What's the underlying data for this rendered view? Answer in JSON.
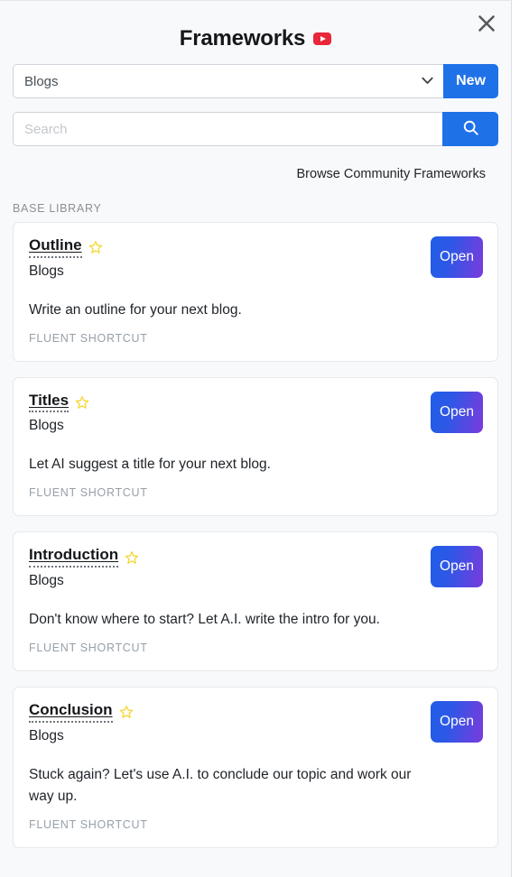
{
  "header": {
    "title": "Frameworks",
    "video_icon": "youtube-play-icon",
    "close_icon": "close-icon"
  },
  "controls": {
    "category_selected": "Blogs",
    "category_options": [
      "Blogs"
    ],
    "new_label": "New",
    "search_placeholder": "Search",
    "search_value": "",
    "search_icon": "search-icon",
    "browse_link": "Browse Community Frameworks"
  },
  "section": {
    "label": "BASE LIBRARY"
  },
  "colors": {
    "accent_blue": "#1f71e8",
    "gradient_start": "#1f5ee8",
    "gradient_end": "#7a3bdd",
    "star_yellow": "#f4dd4a",
    "youtube_red": "#e8273b",
    "panel_bg": "#f8f9fa",
    "card_bg": "#ffffff"
  },
  "cards": [
    {
      "title": "Outline",
      "starred": true,
      "category": "Blogs",
      "description": "Write an outline for your next blog.",
      "tag": "FLUENT SHORTCUT",
      "open_label": "Open"
    },
    {
      "title": "Titles",
      "starred": true,
      "category": "Blogs",
      "description": "Let AI suggest a title for your next blog.",
      "tag": "FLUENT SHORTCUT",
      "open_label": "Open"
    },
    {
      "title": "Introduction",
      "starred": true,
      "category": "Blogs",
      "description": "Don't know where to start? Let A.I. write the intro for you.",
      "tag": "FLUENT SHORTCUT",
      "open_label": "Open"
    },
    {
      "title": "Conclusion",
      "starred": true,
      "category": "Blogs",
      "description": "Stuck again? Let's use A.I. to conclude our topic and work our way up.",
      "tag": "FLUENT SHORTCUT",
      "open_label": "Open"
    }
  ]
}
